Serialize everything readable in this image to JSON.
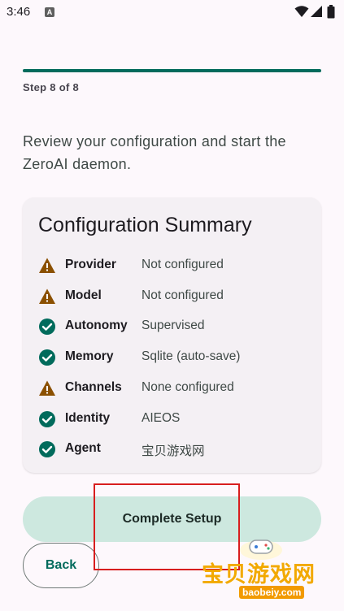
{
  "status_bar": {
    "time": "3:46",
    "notification_badge": "A"
  },
  "progress": {
    "fraction": 1.0,
    "step_label": "Step 8 of 8"
  },
  "intro_text": "Review your configuration and start the ZeroAI daemon.",
  "summary": {
    "title": "Configuration Summary",
    "rows": [
      {
        "status": "warning",
        "icon": "warning-icon",
        "key": "Provider",
        "value": "Not configured"
      },
      {
        "status": "warning",
        "icon": "warning-icon",
        "key": "Model",
        "value": "Not configured"
      },
      {
        "status": "ok",
        "icon": "check-circle-icon",
        "key": "Autonomy",
        "value": "Supervised"
      },
      {
        "status": "ok",
        "icon": "check-circle-icon",
        "key": "Memory",
        "value": "Sqlite (auto-save)"
      },
      {
        "status": "warning",
        "icon": "warning-icon",
        "key": "Channels",
        "value": "None configured"
      },
      {
        "status": "ok",
        "icon": "check-circle-icon",
        "key": "Identity",
        "value": "AIEOS"
      },
      {
        "status": "ok",
        "icon": "check-circle-icon",
        "key": "Agent",
        "value": "宝贝游戏网"
      }
    ]
  },
  "buttons": {
    "complete": "Complete Setup",
    "back": "Back"
  },
  "watermark": {
    "name": "宝贝游戏网",
    "url": "baobeiy.com"
  },
  "colors": {
    "accent": "#016b5c",
    "warning": "#8b5000",
    "ok": "#016b5c",
    "primary_button": "#cde8df",
    "highlight_box": "#d81e1e"
  }
}
